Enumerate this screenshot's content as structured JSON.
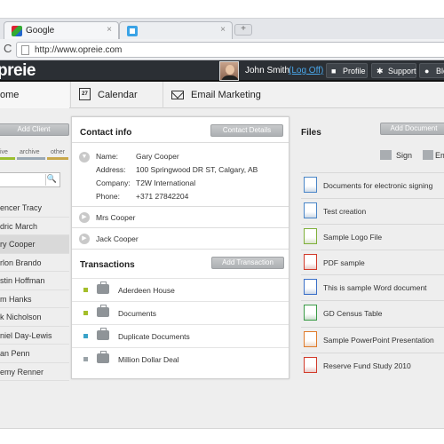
{
  "browser": {
    "tabs": [
      {
        "title": "Google",
        "close": "×"
      },
      {
        "title": "",
        "close": "×"
      }
    ],
    "new_tab": "+",
    "reload_glyph": "C",
    "url": "http://www.opreie.com"
  },
  "header": {
    "logo": "preie",
    "user_name": "John Smith",
    "logoff": "(Log Off)",
    "buttons": [
      {
        "label": "Profile",
        "icon": "user-icon",
        "glyph": "■"
      },
      {
        "label": "Support",
        "icon": "gear-icon",
        "glyph": "✱"
      },
      {
        "label": "Blo",
        "icon": "chat-icon",
        "glyph": "●"
      }
    ]
  },
  "nav": {
    "tabs": [
      {
        "label": "ome"
      },
      {
        "label": "Calendar",
        "icon_text": "27"
      },
      {
        "label": "Email Marketing"
      }
    ]
  },
  "clients": {
    "add_label": "Add Client",
    "filters": [
      {
        "label": "tive",
        "color": "#9bbf2e"
      },
      {
        "label": "archive",
        "color": "#9aa8b4"
      },
      {
        "label": "other",
        "color": "#c8a84a"
      }
    ],
    "search_glyph": "🔍",
    "list": [
      "encer Tracy",
      "dric March",
      "ry Cooper",
      "rlon Brando",
      "stin Hoffman",
      "m Hanks",
      "k Nicholson",
      "niel Day-Lewis",
      "an Penn",
      "emy Renner"
    ]
  },
  "contact": {
    "title": "Contact info",
    "details_button": "Contact Details",
    "fields": [
      {
        "label": "Name:",
        "value": "Gary Cooper"
      },
      {
        "label": "Address:",
        "value": "100 Springwood DR ST, Calgary, AB"
      },
      {
        "label": "Company:",
        "value": "T2W International"
      },
      {
        "label": "Phone:",
        "value": "+371 27842204"
      }
    ],
    "others": [
      "Mrs Cooper",
      "Jack Cooper"
    ]
  },
  "transactions": {
    "title": "Transactions",
    "add_button": "Add Transaction",
    "items": [
      {
        "label": "Aderdeen House",
        "color": "#a4be2a"
      },
      {
        "label": "Documents",
        "color": "#a4be2a"
      },
      {
        "label": "Duplicate Documents",
        "color": "#3aa3c9"
      },
      {
        "label": "Million Dollar Deal",
        "color": "#9aa3a8"
      }
    ]
  },
  "files": {
    "title": "Files",
    "add_button": "Add Document",
    "sign_label": "Sign",
    "em_label": "Em",
    "items": [
      {
        "label": "Documents for electronic signing",
        "icon": "document-icon",
        "color": "#4a86c8"
      },
      {
        "label": "Test creation",
        "icon": "document-icon",
        "color": "#4a86c8"
      },
      {
        "label": "Sample Logo File",
        "icon": "image-file-icon",
        "color": "#7fb03a"
      },
      {
        "label": "PDF sample",
        "icon": "pdf-icon",
        "color": "#d23a2a"
      },
      {
        "label": "This is sample Word document",
        "icon": "word-icon",
        "color": "#3a6fc8"
      },
      {
        "label": "GD Census Table",
        "icon": "excel-icon",
        "color": "#3a9b46"
      },
      {
        "label": "Sample PowerPoint Presentation",
        "icon": "powerpoint-icon",
        "color": "#e07b2a"
      },
      {
        "label": "Reserve Fund Study 2010",
        "icon": "pdf-icon",
        "color": "#d23a2a"
      }
    ]
  }
}
